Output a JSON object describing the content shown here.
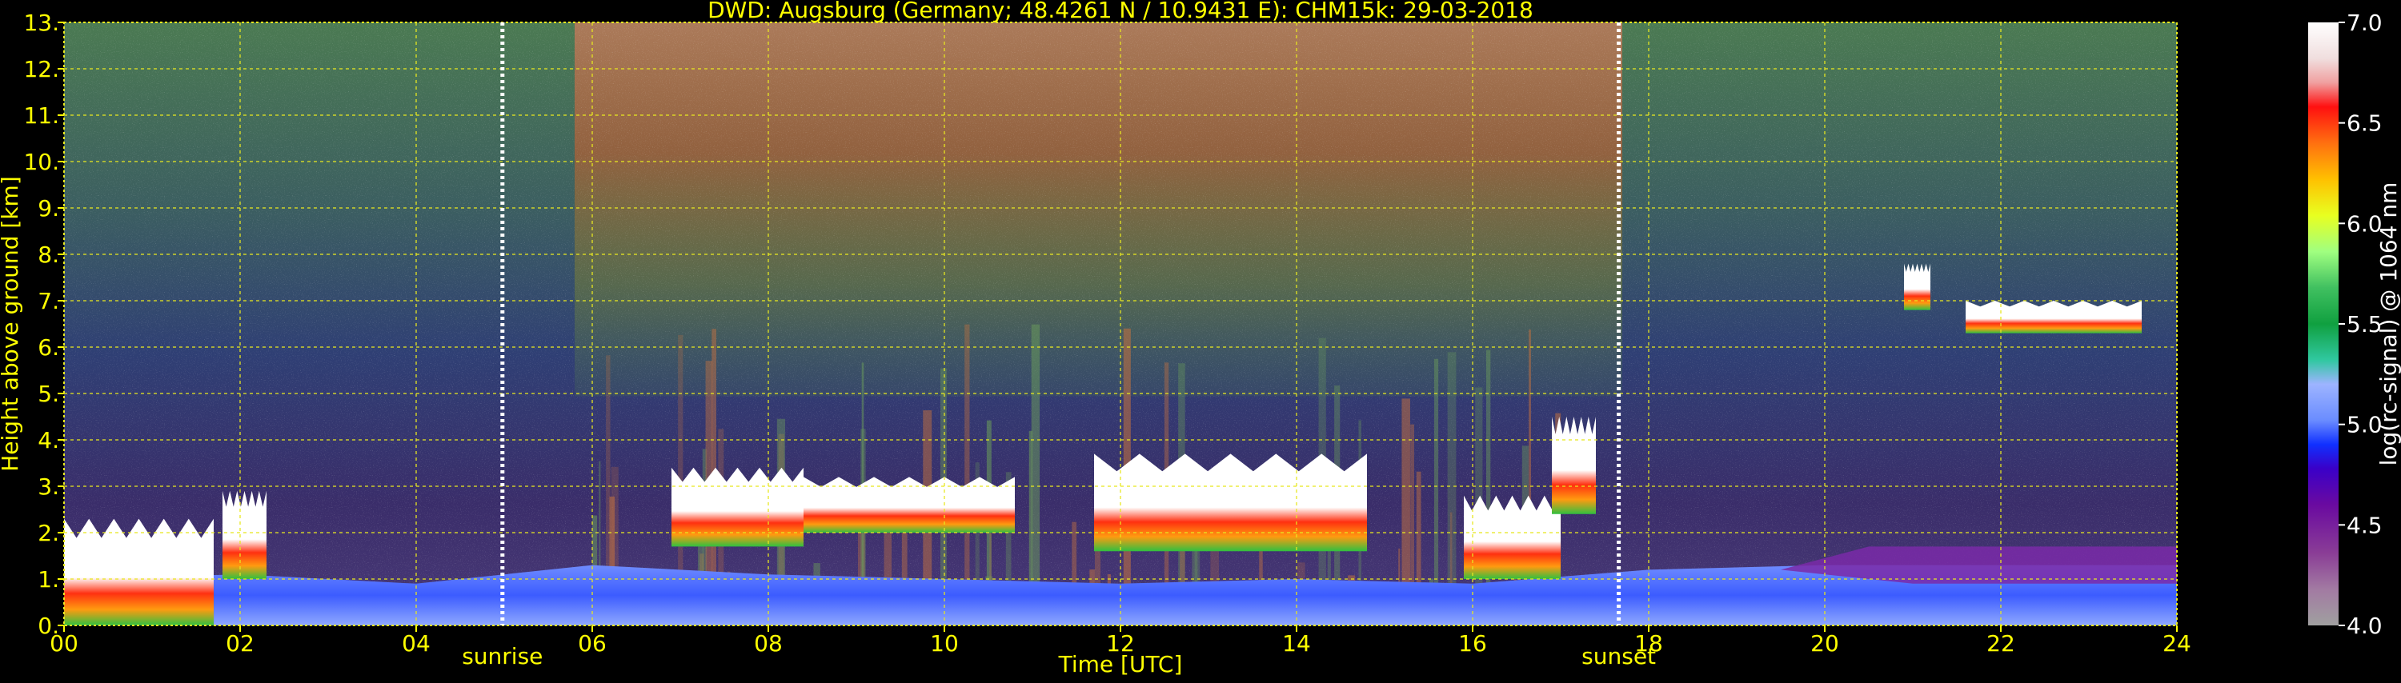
{
  "chart_data": {
    "type": "heatmap",
    "title": "DWD: Augsburg (Germany; 48.4261 N / 10.9431 E):    CHM15k: 29-03-2018",
    "xlabel": "Time [UTC]",
    "ylabel": "Height above ground [km]",
    "xlim": [
      0,
      24
    ],
    "ylim": [
      0,
      13
    ],
    "x_ticks": [
      "00",
      "02",
      "04",
      "06",
      "08",
      "10",
      "12",
      "14",
      "16",
      "18",
      "20",
      "22",
      "24"
    ],
    "y_ticks": [
      "0.",
      "1.",
      "2.",
      "3.",
      "4.",
      "5.",
      "6.",
      "7.",
      "8.",
      "9.",
      "10.",
      "11.",
      "12.",
      "13."
    ],
    "grid": true,
    "annotations": [
      {
        "label": "sunrise",
        "x": 4.98
      },
      {
        "label": "sunset",
        "x": 17.66
      }
    ],
    "colorbar": {
      "label": "log(rc-signal) @ 1064 nm",
      "range": [
        4.0,
        7.0
      ],
      "ticks": [
        "4.0",
        "4.5",
        "5.0",
        "5.5",
        "6.0",
        "6.5",
        "7.0"
      ]
    },
    "features": {
      "boundary_layer_top_km": [
        [
          0,
          1.0
        ],
        [
          2,
          1.1
        ],
        [
          4,
          0.9
        ],
        [
          6,
          1.3
        ],
        [
          8,
          1.1
        ],
        [
          10,
          1.0
        ],
        [
          12,
          0.9
        ],
        [
          14,
          1.0
        ],
        [
          16,
          0.9
        ],
        [
          18,
          1.2
        ],
        [
          20,
          1.3
        ],
        [
          22,
          1.3
        ],
        [
          24,
          1.3
        ]
      ],
      "cloud_layers": [
        {
          "start": 0.0,
          "end": 1.7,
          "base_km": 0.0,
          "top_km": 2.3
        },
        {
          "start": 1.8,
          "end": 2.3,
          "base_km": 1.0,
          "top_km": 2.9
        },
        {
          "start": 6.9,
          "end": 8.4,
          "base_km": 1.7,
          "top_km": 3.4
        },
        {
          "start": 8.4,
          "end": 10.8,
          "base_km": 2.0,
          "top_km": 3.2
        },
        {
          "start": 11.7,
          "end": 14.8,
          "base_km": 1.6,
          "top_km": 3.7
        },
        {
          "start": 15.9,
          "end": 17.0,
          "base_km": 1.0,
          "top_km": 2.8
        },
        {
          "start": 16.9,
          "end": 17.4,
          "base_km": 2.4,
          "top_km": 4.5
        },
        {
          "start": 20.9,
          "end": 21.2,
          "base_km": 6.8,
          "top_km": 7.8
        },
        {
          "start": 21.6,
          "end": 23.6,
          "base_km": 6.3,
          "top_km": 7.0
        }
      ]
    },
    "colors": {
      "title": "#ffff00",
      "axis_text": "#ffff00",
      "colorbar_text": "#ffffff",
      "grid": "#e8e820",
      "marker_line": "#ffffff"
    }
  }
}
